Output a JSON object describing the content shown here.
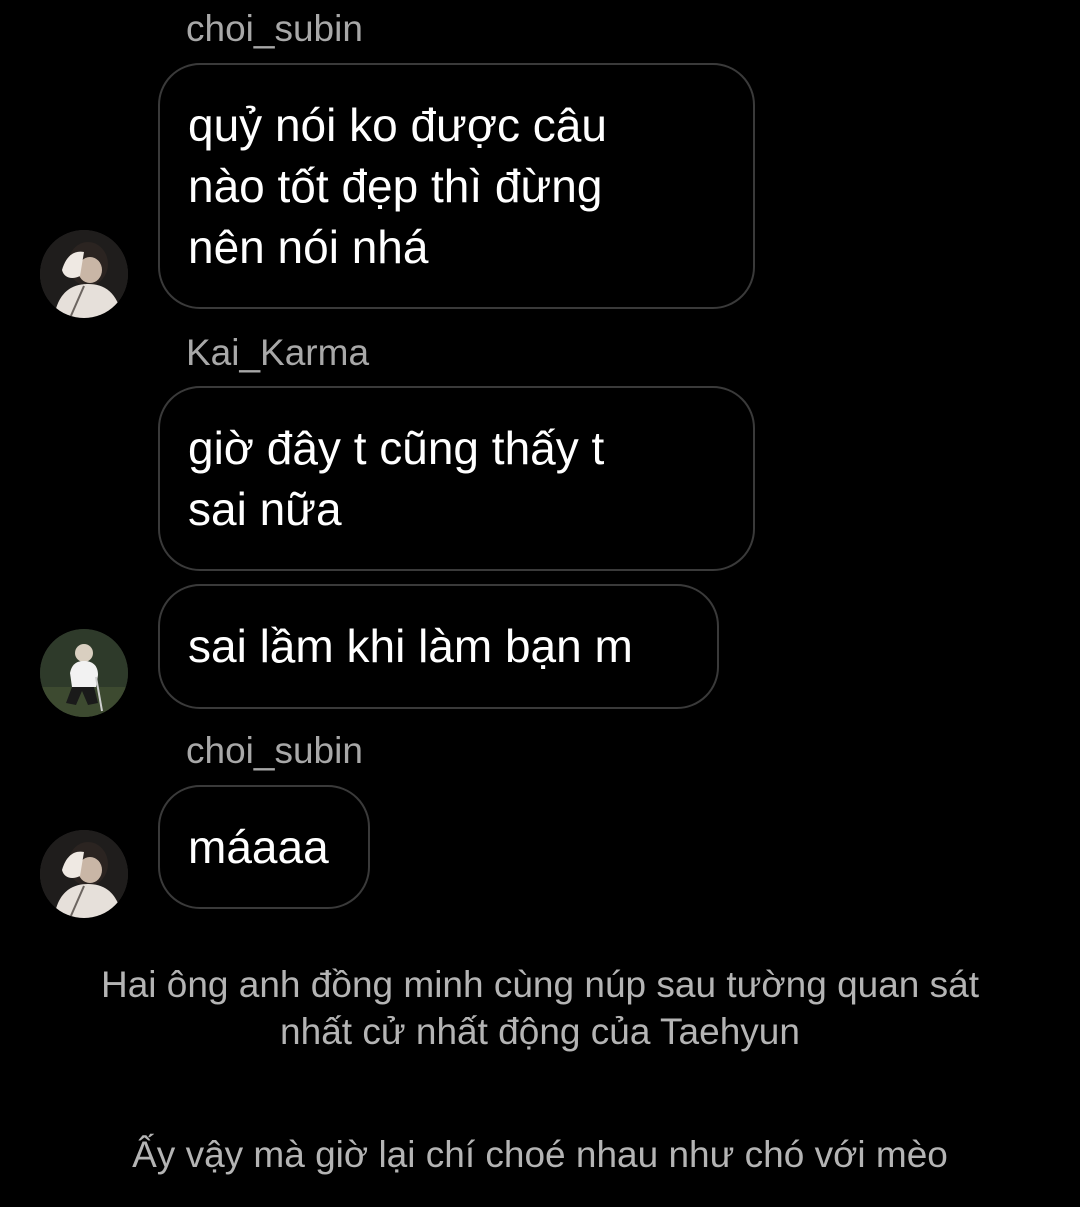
{
  "messages": [
    {
      "sender": "choi_subin",
      "bubbles": [
        "quỷ nói ko được câu\nnào tốt đẹp thì đừng\nnên nói nhá"
      ],
      "avatar": "avatar-choi-subin"
    },
    {
      "sender": "Kai_Karma",
      "bubbles": [
        "giờ đây t cũng thấy t\nsai nữa",
        "sai lầm khi làm bạn m"
      ],
      "avatar": "avatar-kai-karma"
    },
    {
      "sender": "choi_subin",
      "bubbles": [
        "máaaa"
      ],
      "avatar": "avatar-choi-subin"
    }
  ],
  "narration": [
    "Hai ông anh đồng minh cùng núp sau tường quan sát\nnhất cử nhất động của Taehyun",
    "Ấy vậy mà giờ lại chí choé nhau như chó với mèo"
  ],
  "colors": {
    "background": "#000000",
    "bubble_border": "#3a3a3a",
    "sender_text": "#a8a8a8",
    "narration_text": "#b4b4b4"
  }
}
